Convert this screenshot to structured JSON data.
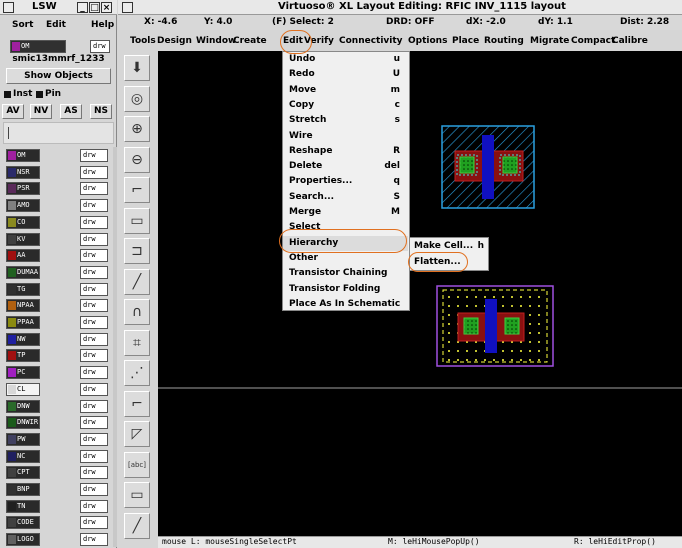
{
  "lsw": {
    "title": "LSW",
    "menu": [
      "Sort",
      "Edit",
      "Help"
    ],
    "current_layer": {
      "name": "OM",
      "purpose": "drw"
    },
    "library": "smic13mmrf_1233",
    "show_objects_label": "Show Objects",
    "checks": {
      "inst": "Inst",
      "pin": "Pin"
    },
    "visibility_buttons": [
      "AV",
      "NV",
      "AS",
      "NS"
    ],
    "layers": [
      {
        "name": "OM",
        "purpose": "drw",
        "color": "#a020a0"
      },
      {
        "name": "NSR",
        "purpose": "drw",
        "color": "#2a2a6a"
      },
      {
        "name": "PSR",
        "purpose": "drw",
        "color": "#5a2a5a"
      },
      {
        "name": "AMO",
        "purpose": "drw",
        "color": "#808080"
      },
      {
        "name": "CO",
        "purpose": "drw",
        "color": "#8a8a20"
      },
      {
        "name": "KV",
        "purpose": "drw",
        "color": "#404040"
      },
      {
        "name": "AA",
        "purpose": "drw",
        "color": "#a01010"
      },
      {
        "name": "DUMAA",
        "purpose": "drw",
        "color": "#206020"
      },
      {
        "name": "TG",
        "purpose": "drw",
        "color": "#303030"
      },
      {
        "name": "NPAA",
        "purpose": "drw",
        "color": "#b06010"
      },
      {
        "name": "PPAA",
        "purpose": "drw",
        "color": "#8a8a10"
      },
      {
        "name": "NW",
        "purpose": "drw",
        "color": "#2020a0"
      },
      {
        "name": "TP",
        "purpose": "drw",
        "color": "#a01010"
      },
      {
        "name": "PC",
        "purpose": "drw",
        "color": "#a020c0"
      },
      {
        "name": "CL",
        "purpose": "drw",
        "color": "#d8d8d8"
      },
      {
        "name": "DNW",
        "purpose": "drw",
        "color": "#2a6a2a"
      },
      {
        "name": "DNWIR",
        "purpose": "drw",
        "color": "#1a5a1a"
      },
      {
        "name": "PW",
        "purpose": "drw",
        "color": "#404060"
      },
      {
        "name": "NC",
        "purpose": "drw",
        "color": "#202060"
      },
      {
        "name": "CPT",
        "purpose": "drw",
        "color": "#404040"
      },
      {
        "name": "BNP",
        "purpose": "drw",
        "color": "#303030"
      },
      {
        "name": "TN",
        "purpose": "drw",
        "color": "#202020"
      },
      {
        "name": "CODE",
        "purpose": "drw",
        "color": "#404040"
      },
      {
        "name": "LOGO",
        "purpose": "drw",
        "color": "#606060"
      }
    ]
  },
  "main": {
    "title": "Virtuoso® XL Layout Editing: RFIC INV_1115 layout",
    "coords": {
      "x": "X: -4.6",
      "y": "Y: 4.0",
      "select": "(F) Select: 2",
      "drd": "DRD: OFF",
      "dx": "dX: -2.0",
      "dy": "dY: 1.1",
      "dist": "Dist: 2.28"
    },
    "menubar": [
      "Tools",
      "Design",
      "Window",
      "Create",
      "Edit",
      "Verify",
      "Connectivity",
      "Options",
      "Place",
      "Routing",
      "Migrate",
      "Compact",
      "Calibre"
    ],
    "edit_menu": [
      {
        "label": "Undo",
        "key": "u"
      },
      {
        "label": "Redo",
        "key": "U"
      },
      {
        "label": "Move",
        "key": "m"
      },
      {
        "label": "Copy",
        "key": "c"
      },
      {
        "label": "Stretch",
        "key": "s"
      },
      {
        "label": "Wire",
        "key": ""
      },
      {
        "label": "Reshape",
        "key": "R"
      },
      {
        "label": "Delete",
        "key": "del"
      },
      {
        "label": "Properties...",
        "key": "q"
      },
      {
        "label": "Search...",
        "key": "S"
      },
      {
        "label": "Merge",
        "key": "M"
      },
      {
        "label": "Select",
        "key": ""
      },
      {
        "label": "Hierarchy",
        "key": ""
      },
      {
        "label": "Other",
        "key": ""
      },
      {
        "label": "Transistor Chaining",
        "key": ""
      },
      {
        "label": "Transistor Folding",
        "key": ""
      },
      {
        "label": "Place As In Schematic",
        "key": ""
      }
    ],
    "hierarchy_submenu": [
      {
        "label": "Make Cell...",
        "key": "h"
      },
      {
        "label": "Flatten...",
        "key": ""
      }
    ],
    "status": {
      "left": "mouse L: mouseSingleSelectPt",
      "middle": "M: leHiMousePopUp()",
      "right": "R: leHiEditProp()"
    },
    "highlight_color": "#e07020"
  }
}
